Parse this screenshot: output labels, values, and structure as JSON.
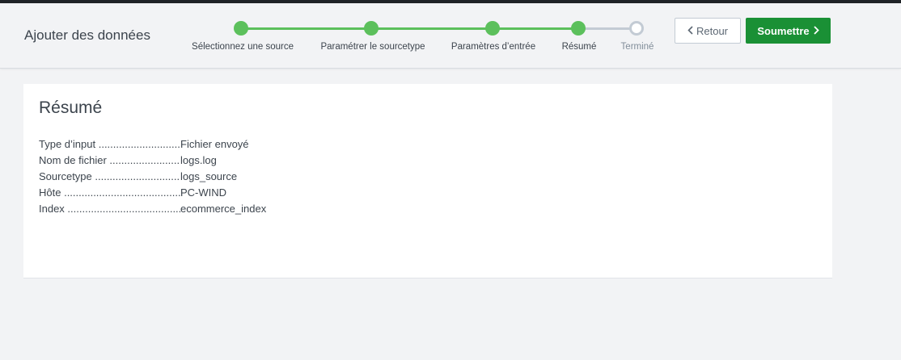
{
  "header": {
    "title": "Ajouter des données"
  },
  "stepper": {
    "steps": [
      {
        "label": "Sélectionnez une source",
        "state": "done"
      },
      {
        "label": "Paramétrer le sourcetype",
        "state": "done"
      },
      {
        "label": "Paramètres d’entrée",
        "state": "done"
      },
      {
        "label": "Résumé",
        "state": "done"
      },
      {
        "label": "Terminé",
        "state": "todo"
      }
    ],
    "colors": {
      "done": "#5cc05c",
      "todo": "#c3cbd4"
    }
  },
  "buttons": {
    "back_label": "Retour",
    "submit_label": "Soumettre",
    "back_icon": "chevron-left-icon",
    "submit_icon": "chevron-right-icon",
    "submit_color": "#1a9035"
  },
  "summary": {
    "title": "Résumé",
    "rows": [
      {
        "key": "Type d’input",
        "value": "Fichier envoyé"
      },
      {
        "key": "Nom de fichier",
        "value": "logs.log"
      },
      {
        "key": "Sourcetype",
        "value": "logs_source"
      },
      {
        "key": "Hôte",
        "value": "PC-WIND"
      },
      {
        "key": "Index",
        "value": "ecommerce_index"
      }
    ]
  }
}
